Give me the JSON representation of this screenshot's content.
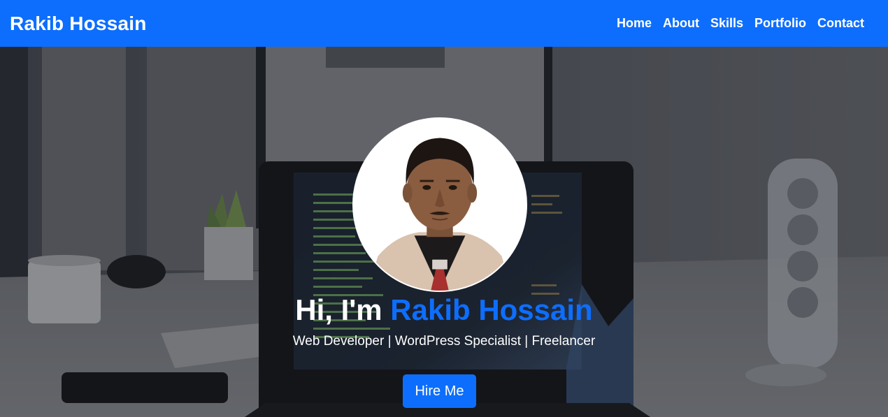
{
  "navbar": {
    "brand": "Rakib Hossain",
    "links": [
      "Home",
      "About",
      "Skills",
      "Portfolio",
      "Contact"
    ]
  },
  "hero": {
    "greeting": "Hi, I'm ",
    "name": "Rakib Hossain",
    "tagline": "Web Developer | WordPress Specialist | Freelancer",
    "cta_label": "Hire Me"
  },
  "colors": {
    "primary": "#0d6efd",
    "text_light": "#ffffff"
  },
  "icons": {
    "avatar": "profile-photo"
  }
}
